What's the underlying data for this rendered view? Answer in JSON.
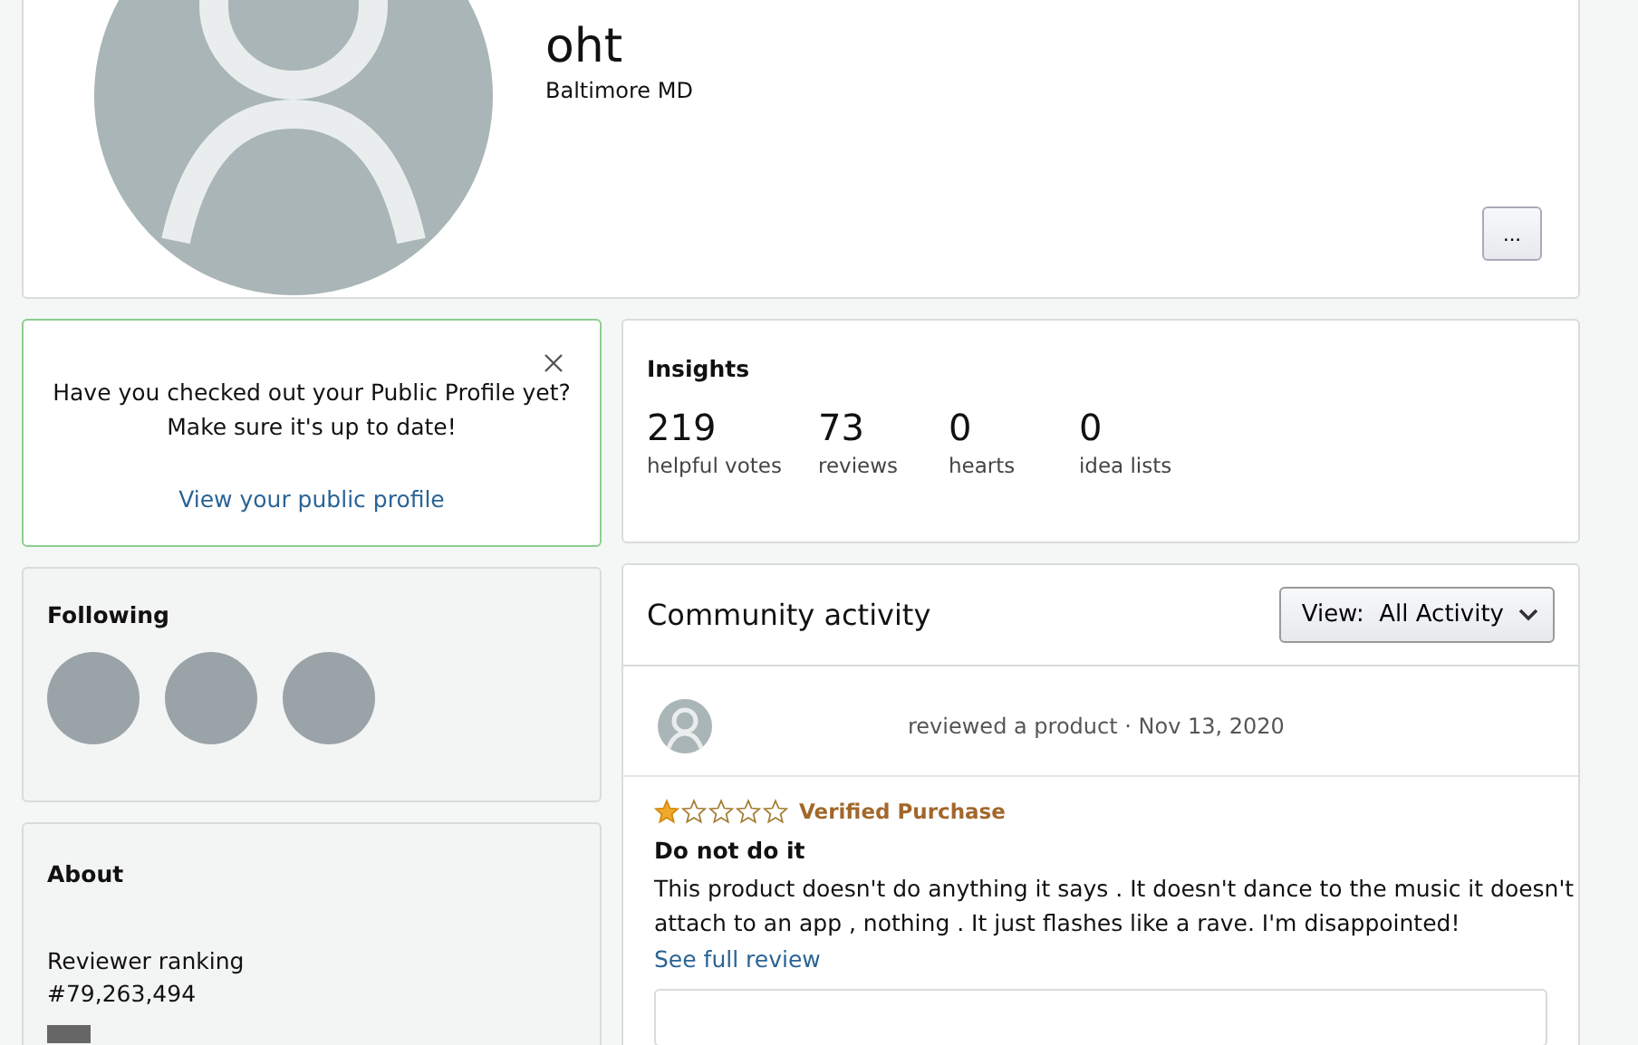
{
  "profile": {
    "name": "oht",
    "location": "Baltimore MD",
    "more_button": "..."
  },
  "notice": {
    "text_line_1": "Have you checked out your Public Profile yet?",
    "text_line_2": "Make sure it's up to date!",
    "link": "View your public profile"
  },
  "insights": {
    "title": "Insights",
    "stats": [
      {
        "value": "219",
        "label": "helpful votes"
      },
      {
        "value": "73",
        "label": "reviews"
      },
      {
        "value": "0",
        "label": "hearts"
      },
      {
        "value": "0",
        "label": "idea lists"
      }
    ]
  },
  "following": {
    "title": "Following",
    "avatars": [
      {
        "kind": "photo"
      },
      {
        "kind": "photo"
      },
      {
        "kind": "photo"
      }
    ]
  },
  "about": {
    "title": "About",
    "ranking_label": "Reviewer ranking",
    "ranking": "#79,263,494"
  },
  "community": {
    "title": "Community activity",
    "view_label": "View:",
    "view_value": "All Activity",
    "activity": {
      "action": "reviewed a product · Nov 13, 2020",
      "stars": 1,
      "badge": "Verified Purchase",
      "review_title": "Do not do it",
      "review_text": "This product doesn't do anything it says . It doesn't dance to the music it doesn't attach to an app , nothing . It just flashes like a rave. I'm disappointed!",
      "link": "See full review"
    }
  }
}
